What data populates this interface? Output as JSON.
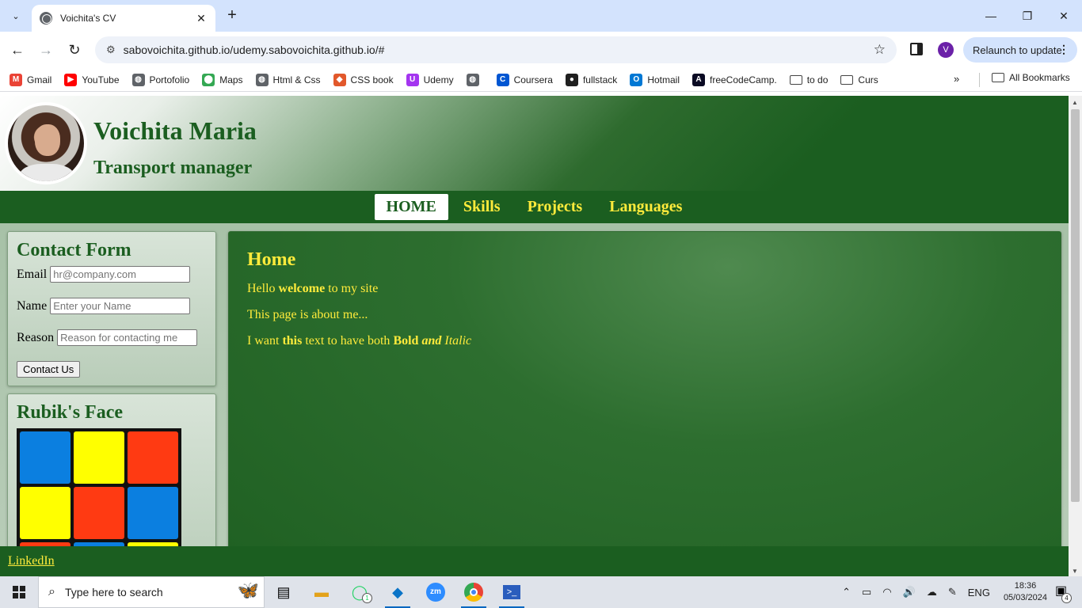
{
  "browser": {
    "tab_title": "Voichita's CV",
    "url": "sabovoichita.github.io/udemy.sabovoichita.github.io/#",
    "relaunch_label": "Relaunch to update",
    "profile_initial": "V",
    "bookmarks": [
      {
        "label": "Gmail",
        "icon": "gmail-icon",
        "color": "#ea4335",
        "glyph": "M"
      },
      {
        "label": "YouTube",
        "icon": "youtube-icon",
        "color": "#ff0000",
        "glyph": "▶"
      },
      {
        "label": "Portofolio",
        "icon": "globe-icon",
        "color": "#5f6368",
        "glyph": "◍"
      },
      {
        "label": "Maps",
        "icon": "maps-pin-icon",
        "color": "#34a853",
        "glyph": "⬤"
      },
      {
        "label": "Html & Css",
        "icon": "globe-icon",
        "color": "#5f6368",
        "glyph": "◍"
      },
      {
        "label": "CSS book",
        "icon": "css-book-icon",
        "color": "#e2582b",
        "glyph": "◆"
      },
      {
        "label": "Udemy",
        "icon": "udemy-icon",
        "color": "#a435f0",
        "glyph": "U"
      },
      {
        "label": "",
        "icon": "globe-icon",
        "color": "#5f6368",
        "glyph": "◍"
      },
      {
        "label": "Coursera",
        "icon": "coursera-icon",
        "color": "#0056d2",
        "glyph": "C"
      },
      {
        "label": "fullstack",
        "icon": "github-icon",
        "color": "#1f1f1f",
        "glyph": "●"
      },
      {
        "label": "Hotmail",
        "icon": "outlook-icon",
        "color": "#0078d4",
        "glyph": "O"
      },
      {
        "label": "freeCodeCamp.",
        "icon": "freecodecamp-icon",
        "color": "#0a0a23",
        "glyph": "A"
      },
      {
        "label": "to do",
        "icon": "folder-icon",
        "color": "",
        "glyph": ""
      },
      {
        "label": "Curs",
        "icon": "folder-icon",
        "color": "",
        "glyph": ""
      }
    ],
    "all_bookmarks_label": "All Bookmarks"
  },
  "page": {
    "name": "Voichita Maria",
    "role": "Transport manager",
    "nav": [
      {
        "label": "HOME",
        "active": true
      },
      {
        "label": "Skills",
        "active": false
      },
      {
        "label": "Projects",
        "active": false
      },
      {
        "label": "Languages",
        "active": false
      }
    ],
    "contact": {
      "title": "Contact Form",
      "email_label": "Email",
      "email_placeholder": "hr@company.com",
      "name_label": "Name",
      "name_placeholder": "Enter your Name",
      "reason_label": "Reason",
      "reason_placeholder": "Reason for contacting me",
      "button_label": "Contact Us"
    },
    "rubik": {
      "title": "Rubik's Face",
      "cells": [
        "#0b7fe0",
        "#ffff00",
        "#ff3a12",
        "#ffff00",
        "#ff3a12",
        "#0b7fe0",
        "#ff3a12",
        "#0b7fe0",
        "#ffff00"
      ]
    },
    "main": {
      "title": "Home",
      "p1_a": "Hello ",
      "p1_b": "welcome",
      "p1_c": " to my site",
      "p2": "This page is about me...",
      "p3_a": "I want ",
      "p3_b": "this",
      "p3_c": " text to have both ",
      "p3_d": "Bold",
      "p3_e": "and",
      "p3_f": "Italic"
    },
    "footer_link": "LinkedIn",
    "colors": {
      "accent_green": "#1b5e20",
      "accent_yellow": "#ffeb3b"
    }
  },
  "taskbar": {
    "search_placeholder": "Type here to search",
    "whatsapp_badge": "1",
    "tray_lang": "ENG",
    "time": "18:36",
    "date": "05/03/2024",
    "notification_count": "4"
  }
}
